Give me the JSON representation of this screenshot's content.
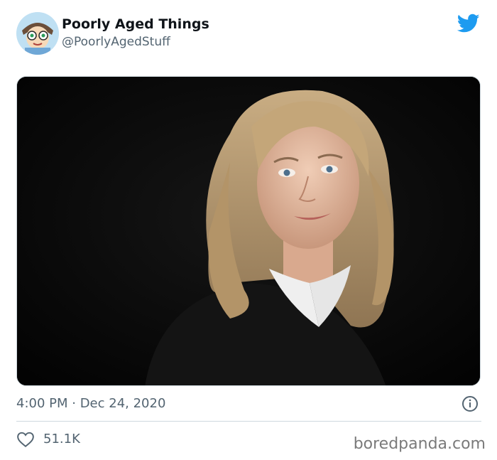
{
  "tweet": {
    "display_name": "Poorly Aged Things",
    "handle": "@PoorlyAgedStuff",
    "timestamp": "4:00 PM · Dec 24, 2020",
    "likes": "51.1K"
  },
  "icons": {
    "brand": "twitter-bird-icon",
    "info": "info-icon",
    "like": "heart-icon"
  },
  "colors": {
    "twitter_blue": "#1d9bf0",
    "secondary_text": "#536471",
    "divider": "#cfd9de"
  },
  "watermark": "boredpanda.com"
}
